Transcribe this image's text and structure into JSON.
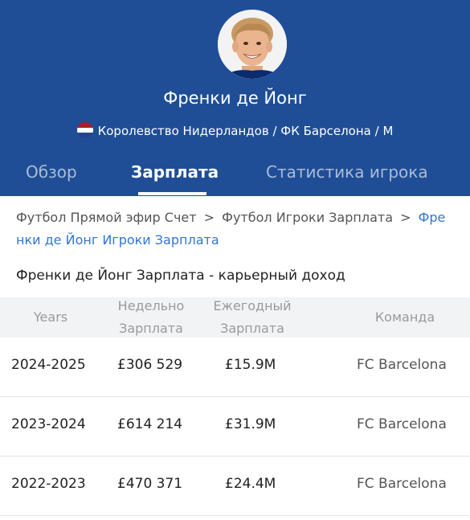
{
  "player": {
    "name": "Френки де Йонг",
    "country_club": "Королевство Нидерландов / ФК Барселона / М"
  },
  "tabs": [
    {
      "label": "Обзор",
      "active": false
    },
    {
      "label": "Зарплата",
      "active": true
    },
    {
      "label": "Статистика игрока",
      "active": false
    }
  ],
  "breadcrumb": {
    "items": [
      "Футбол Прямой эфир Счет",
      "Футбол Игроки Зарплата"
    ],
    "current_part1": "Фре",
    "current_part2": "нки де Йонг Игроки Зарплата",
    "separator": ">"
  },
  "subtitle": "Френки де Йонг Зарплата - карьерный доход",
  "table": {
    "headers": [
      [
        "Years"
      ],
      [
        "Недельно",
        "Зарплата"
      ],
      [
        "Ежегодный",
        "Зарплата"
      ],
      [
        "Команда"
      ]
    ],
    "rows": [
      {
        "years": "2024-2025",
        "weekly": "£306 529",
        "annual": "£15.9M",
        "team": "FC Barcelona"
      },
      {
        "years": "2023-2024",
        "weekly": "£614 214",
        "annual": "£31.9M",
        "team": "FC Barcelona"
      },
      {
        "years": "2022-2023",
        "weekly": "£470 371",
        "annual": "£24.4M",
        "team": "FC Barcelona"
      }
    ]
  },
  "colors": {
    "header_bg": "#1f4e96",
    "link": "#2f76d6",
    "table_head_bg": "#f2f3f5"
  },
  "icons": {
    "avatar": "player-photo",
    "flag": "netherlands-flag-icon",
    "breadcrumb_separator": "chevron-right-icon"
  }
}
